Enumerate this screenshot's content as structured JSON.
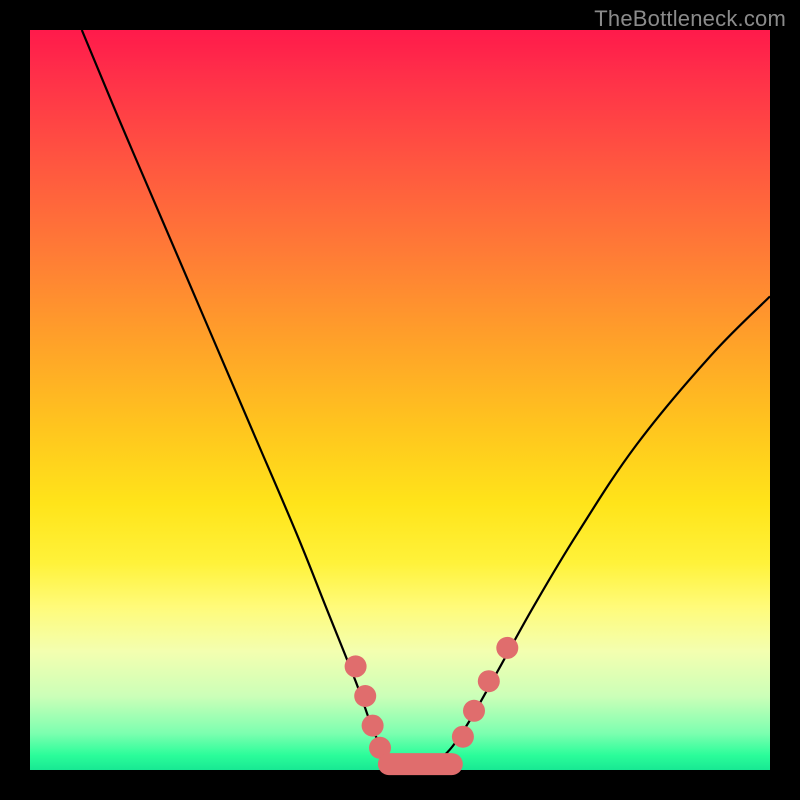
{
  "watermark": "TheBottleneck.com",
  "colors": {
    "dot": "#e06d6d",
    "curve": "#000000",
    "gradient_top": "#ff1a4b",
    "gradient_bottom": "#18e893",
    "frame": "#000000"
  },
  "chart_data": {
    "type": "line",
    "title": "",
    "xlabel": "",
    "ylabel": "",
    "xlim": [
      0,
      100
    ],
    "ylim": [
      0,
      100
    ],
    "note": "Axes unlabeled; values are read as percentage of plot width (x) and plot height (y, 0 at bottom). Curve is a bottleneck V-shape touching y≈0 near x≈48–57.",
    "series": [
      {
        "name": "bottleneck-curve",
        "x": [
          7,
          12,
          18,
          24,
          30,
          36,
          40,
          44,
          47,
          50,
          53,
          56,
          59,
          63,
          68,
          74,
          82,
          92,
          100
        ],
        "y": [
          100,
          88,
          74,
          60,
          46,
          32,
          22,
          12,
          4,
          0.5,
          0.5,
          2,
          6,
          13,
          22,
          32,
          44,
          56,
          64
        ]
      }
    ],
    "markers": [
      {
        "kind": "dot",
        "x": 44.0,
        "y": 14.0
      },
      {
        "kind": "dot",
        "x": 45.3,
        "y": 10.0
      },
      {
        "kind": "dot",
        "x": 46.3,
        "y": 6.0
      },
      {
        "kind": "dot",
        "x": 47.3,
        "y": 3.0
      },
      {
        "kind": "pill",
        "x0": 48.5,
        "x1": 57.0,
        "y": 0.8
      },
      {
        "kind": "dot",
        "x": 58.5,
        "y": 4.5
      },
      {
        "kind": "dot",
        "x": 60.0,
        "y": 8.0
      },
      {
        "kind": "dot",
        "x": 62.0,
        "y": 12.0
      },
      {
        "kind": "dot",
        "x": 64.5,
        "y": 16.5
      }
    ]
  }
}
